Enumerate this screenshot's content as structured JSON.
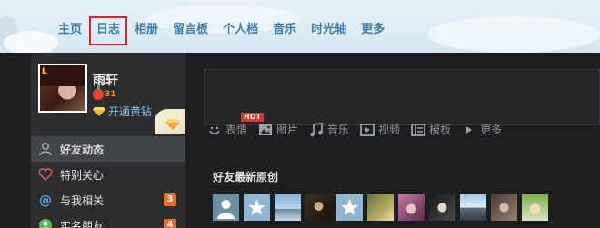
{
  "nav": {
    "items": [
      {
        "label": "主页"
      },
      {
        "label": "日志",
        "active": true
      },
      {
        "label": "相册"
      },
      {
        "label": "留言板"
      },
      {
        "label": "个人档"
      },
      {
        "label": "音乐"
      },
      {
        "label": "时光轴"
      },
      {
        "label": "更多"
      }
    ]
  },
  "profile": {
    "name": "雨轩",
    "level_badge": "L",
    "vip_level": "31",
    "open_link": "开通黄钻"
  },
  "menu": {
    "items": [
      {
        "label": "好友动态",
        "icon": "friends-icon",
        "active": true
      },
      {
        "label": "特别关心",
        "icon": "heart-icon"
      },
      {
        "label": "与我相关",
        "icon": "at-icon",
        "badge": "3"
      },
      {
        "label": "实名朋友",
        "icon": "contacts-icon",
        "badge": "4"
      }
    ]
  },
  "toolbar": {
    "items": [
      {
        "label": "表情",
        "icon": "smiley-icon"
      },
      {
        "label": "图片",
        "icon": "image-icon"
      },
      {
        "label": "音乐",
        "icon": "music-icon"
      },
      {
        "label": "视频",
        "icon": "video-icon"
      },
      {
        "label": "模板",
        "icon": "template-icon"
      },
      {
        "label": "更多",
        "icon": "triangle-right-icon"
      }
    ],
    "hot_badge": "HOT"
  },
  "feed": {
    "section_title": "好友最新原创"
  },
  "colors": {
    "nav_text": "#3d7ea8",
    "active_outline": "#e3221c",
    "badge_orange": "#f06b1e",
    "link_blue": "#79c0e8"
  }
}
